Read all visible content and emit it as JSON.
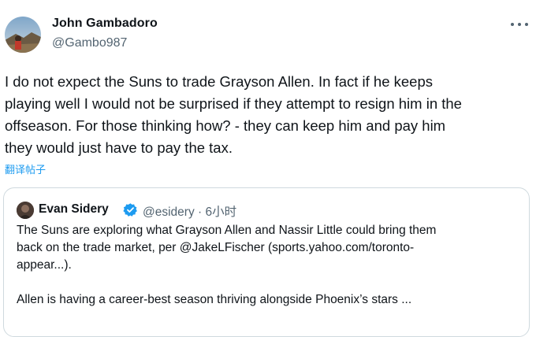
{
  "tweet": {
    "author_name": "John Gambadoro",
    "author_handle": "@Gambo987",
    "text_lines": [
      "I do not expect the Suns to trade Grayson Allen. In fact if he keeps",
      "playing well I would not be surprised if they attempt to resign him in the",
      "offseason. For those thinking how? - they can keep him and pay him",
      "they would just have to pay the tax."
    ],
    "translate_label": "翻译帖子",
    "more_icon": "more-horizontal-icon"
  },
  "quote": {
    "author_name": "Evan Sidery",
    "verified_icon": "verified-badge-icon",
    "author_handle": "@esidery",
    "separator": "·",
    "timestamp": "6小时",
    "text_lines": [
      "The Suns are exploring what Grayson Allen and Nassir Little could bring them",
      "back on the trade market, per @JakeLFischer (sports.yahoo.com/toronto-",
      "appear...)."
    ],
    "text_lines_2": [
      "Allen is having a career-best season thriving alongside Phoenix’s stars ..."
    ]
  },
  "colors": {
    "link": "#1d9bf0",
    "secondary_text": "#536471",
    "border": "#cfd9de"
  }
}
